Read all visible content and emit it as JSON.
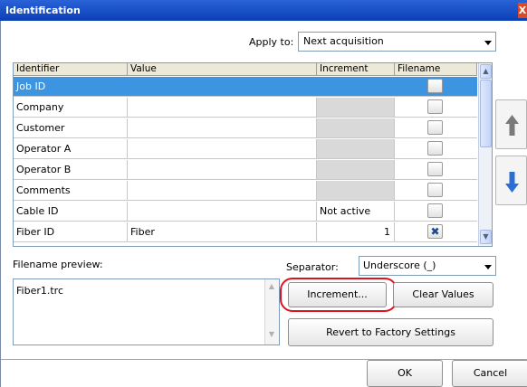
{
  "window": {
    "title": "Identification",
    "close_label": "X"
  },
  "apply_to": {
    "label": "Apply to:",
    "value": "Next acquisition"
  },
  "grid": {
    "columns": [
      "Identifier",
      "Value",
      "Increment",
      "Filename"
    ],
    "rows": [
      {
        "identifier": "Job ID",
        "value": "",
        "increment": "",
        "filename_checked": false,
        "selected": true,
        "increment_disabled": false
      },
      {
        "identifier": "Company",
        "value": "",
        "increment": "",
        "filename_checked": false,
        "selected": false,
        "increment_disabled": true
      },
      {
        "identifier": "Customer",
        "value": "",
        "increment": "",
        "filename_checked": false,
        "selected": false,
        "increment_disabled": true
      },
      {
        "identifier": "Operator A",
        "value": "",
        "increment": "",
        "filename_checked": false,
        "selected": false,
        "increment_disabled": true
      },
      {
        "identifier": "Operator B",
        "value": "",
        "increment": "",
        "filename_checked": false,
        "selected": false,
        "increment_disabled": true
      },
      {
        "identifier": "Comments",
        "value": "",
        "increment": "",
        "filename_checked": false,
        "selected": false,
        "increment_disabled": true
      },
      {
        "identifier": "Cable ID",
        "value": "",
        "increment": "Not active",
        "filename_checked": false,
        "selected": false,
        "increment_disabled": false
      },
      {
        "identifier": "Fiber ID",
        "value": "Fiber",
        "increment": "1",
        "filename_checked": true,
        "selected": false,
        "increment_disabled": false
      }
    ]
  },
  "icons": {
    "move_up": "arrow-up-icon",
    "move_down": "arrow-down-icon",
    "checked_mark": "x-mark-icon"
  },
  "colors": {
    "selection": "#3d95e2",
    "title_bar": "#0b3fb5",
    "highlight": "#e0121e",
    "arrow_down": "#2a6fd6",
    "arrow_up": "#7a7a7a"
  },
  "filename_preview": {
    "label": "Filename preview:",
    "text": "Fiber1.trc"
  },
  "separator": {
    "label": "Separator:",
    "value": "Underscore (_)"
  },
  "buttons": {
    "increment": "Increment...",
    "clear_values": "Clear Values",
    "revert": "Revert to Factory Settings",
    "ok": "OK",
    "cancel": "Cancel"
  }
}
